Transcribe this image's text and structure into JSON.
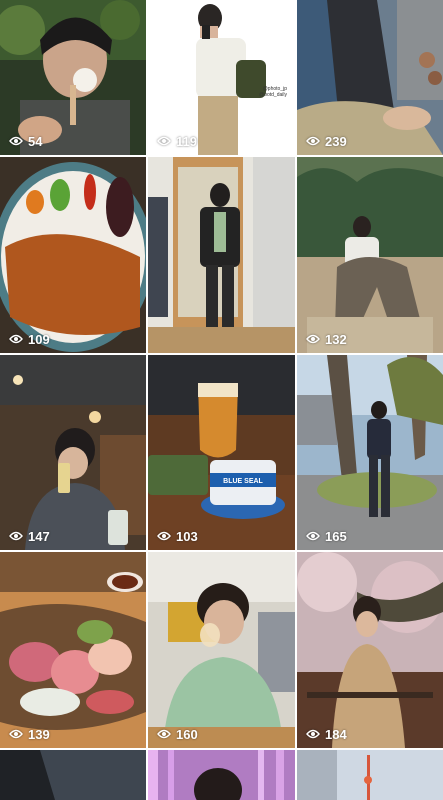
{
  "grid": {
    "tiles": [
      {
        "views": "54"
      },
      {
        "views": "119",
        "caption_lines": [
          "@photo_jp",
          "@ootd_daily"
        ]
      },
      {
        "views": "239"
      },
      {
        "views": "109"
      },
      {
        "views": ""
      },
      {
        "views": "132"
      },
      {
        "views": "147"
      },
      {
        "views": "103",
        "cup_text": "BLUE SEAL"
      },
      {
        "views": "165"
      },
      {
        "views": "139"
      },
      {
        "views": "160"
      },
      {
        "views": "184"
      },
      {
        "views": ""
      },
      {
        "views": ""
      },
      {
        "views": ""
      }
    ]
  },
  "icons": {
    "views": "eye-icon"
  }
}
